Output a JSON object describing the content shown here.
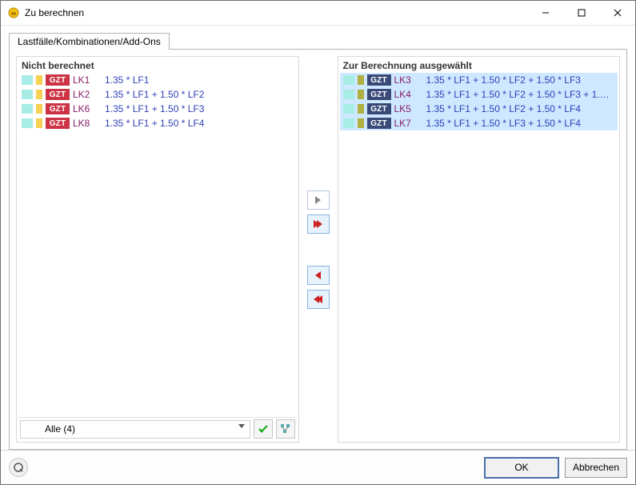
{
  "window": {
    "title": "Zu berechnen",
    "buttons": {
      "min": "—",
      "max": "☐",
      "close": "✕"
    }
  },
  "tab": {
    "label": "Lastfälle/Kombinationen/Add-Ons"
  },
  "left": {
    "header": "Nicht berechnet",
    "rows": [
      {
        "badge": "GZT",
        "code": "LK1",
        "formula": "1.35 * LF1"
      },
      {
        "badge": "GZT",
        "code": "LK2",
        "formula": "1.35 * LF1 + 1.50 * LF2"
      },
      {
        "badge": "GZT",
        "code": "LK6",
        "formula": "1.35 * LF1 + 1.50 * LF3"
      },
      {
        "badge": "GZT",
        "code": "LK8",
        "formula": "1.35 * LF1 + 1.50 * LF4"
      }
    ],
    "filter": "Alle (4)"
  },
  "right": {
    "header": "Zur Berechnung ausgewählt",
    "rows": [
      {
        "badge": "GZT",
        "code": "LK3",
        "formula": "1.35 * LF1 + 1.50 * LF2 + 1.50 * LF3"
      },
      {
        "badge": "GZT",
        "code": "LK4",
        "formula": "1.35 * LF1 + 1.50 * LF2 + 1.50 * LF3 + 1.50 …"
      },
      {
        "badge": "GZT",
        "code": "LK5",
        "formula": "1.35 * LF1 + 1.50 * LF2 + 1.50 * LF4"
      },
      {
        "badge": "GZT",
        "code": "LK7",
        "formula": "1.35 * LF1 + 1.50 * LF3 + 1.50 * LF4"
      }
    ]
  },
  "footer": {
    "ok": "OK",
    "cancel": "Abbrechen"
  },
  "transfer_names": {
    "add": "move-right-button",
    "add_all": "move-all-right-button",
    "remove": "move-left-button",
    "remove_all": "move-all-left-button"
  }
}
